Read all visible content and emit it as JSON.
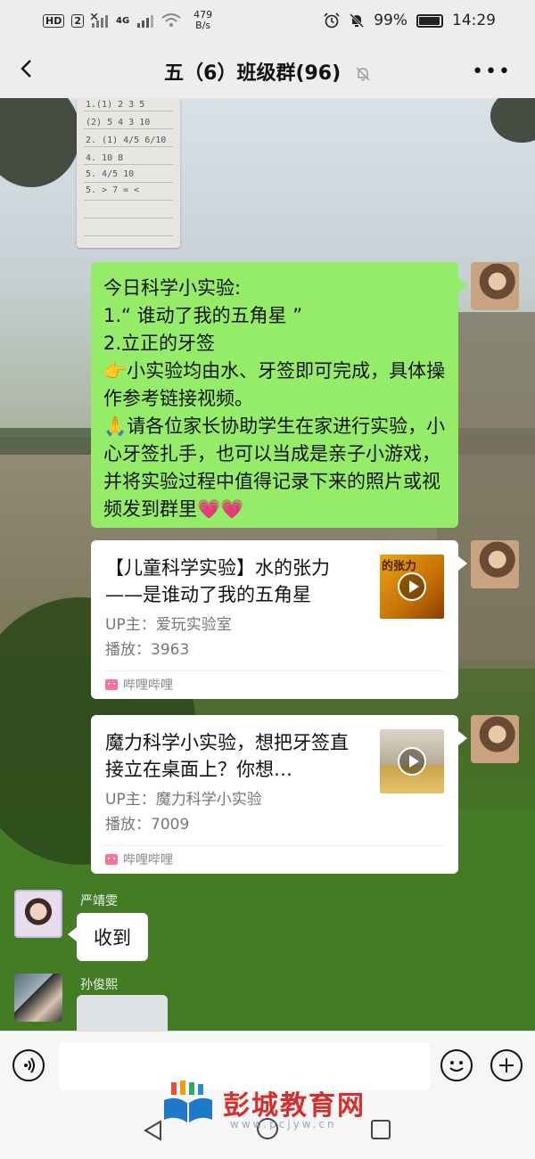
{
  "status_bar": {
    "hd": "HD",
    "sim": "2",
    "net": "4G",
    "speed_value": "479",
    "speed_unit": "B/s",
    "battery": "99%",
    "time": "14:29"
  },
  "header": {
    "title": "五（6）班级群(96)"
  },
  "messages": {
    "science_post": {
      "lines": [
        "今日科学小实验:",
        "1.“ 谁动了我的五角星 ”",
        "2.立正的牙签",
        "👉小实验均由水、牙签即可完成，具体操作参考链接视频。",
        "🙏请各位家长协助学生在家进行实验，小心牙签扎手，也可以当成是亲子小游戏，并将实验过程中值得记录下来的照片或视频发到群里💗💗"
      ]
    },
    "card1": {
      "title": "【儿童科学实验】水的张力——是谁动了我的五角星",
      "uploader": "UP主：爱玩实验室",
      "plays": "播放：3963",
      "source": "哔哩哔哩",
      "thumb_text": "的张力"
    },
    "card2": {
      "title": "魔力科学小实验，想把牙签直接立在桌面上？你想…",
      "uploader": "UP主：魔力科学小实验",
      "plays": "播放：7009",
      "source": "哔哩哔哩"
    },
    "reply1": {
      "sender": "严靖雯",
      "text": "收到"
    },
    "reply2": {
      "sender": "孙俊熙"
    },
    "homework_image": {
      "lines": [
        "1.(1) 2  3  5",
        "(2) 5  4  3  10",
        "2. (1) 4/5  6/10",
        "4. 10  8",
        "5.  4/5  10",
        "5. > 7 = <"
      ]
    }
  },
  "watermark": {
    "text": "彭城教育网",
    "url": "www.pcjyw.cn"
  },
  "colors": {
    "green_bubble": "#95ec69",
    "watermark_red": "#d22f2f",
    "bilibili_pink": "#fb7299"
  }
}
